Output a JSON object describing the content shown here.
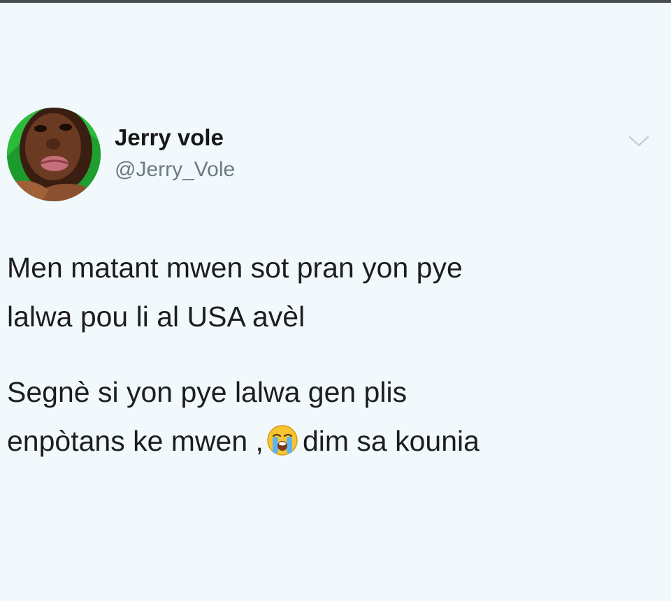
{
  "tweet": {
    "display_name": "Jerry vole",
    "handle": "@Jerry_Vole",
    "avatar_icon": "profile-photo",
    "menu_icon": "chevron-down-icon",
    "paragraph_1_line_1": "Men matant mwen sot pran yon pye",
    "paragraph_1_line_2": "lalwa pou li al USA avèl",
    "paragraph_2_line_1": "Segnè si yon pye lalwa gen plis",
    "paragraph_2_line_2_before_emoji": "enpòtans ke mwen ,",
    "emoji_icon": "loudly-crying-face-emoji",
    "paragraph_2_line_2_after_emoji": "dim sa kounia"
  },
  "colors": {
    "background": "#f2f9fc",
    "text": "#1d1d1d",
    "handle": "#6c7a85",
    "chevron": "#c5ced6"
  }
}
